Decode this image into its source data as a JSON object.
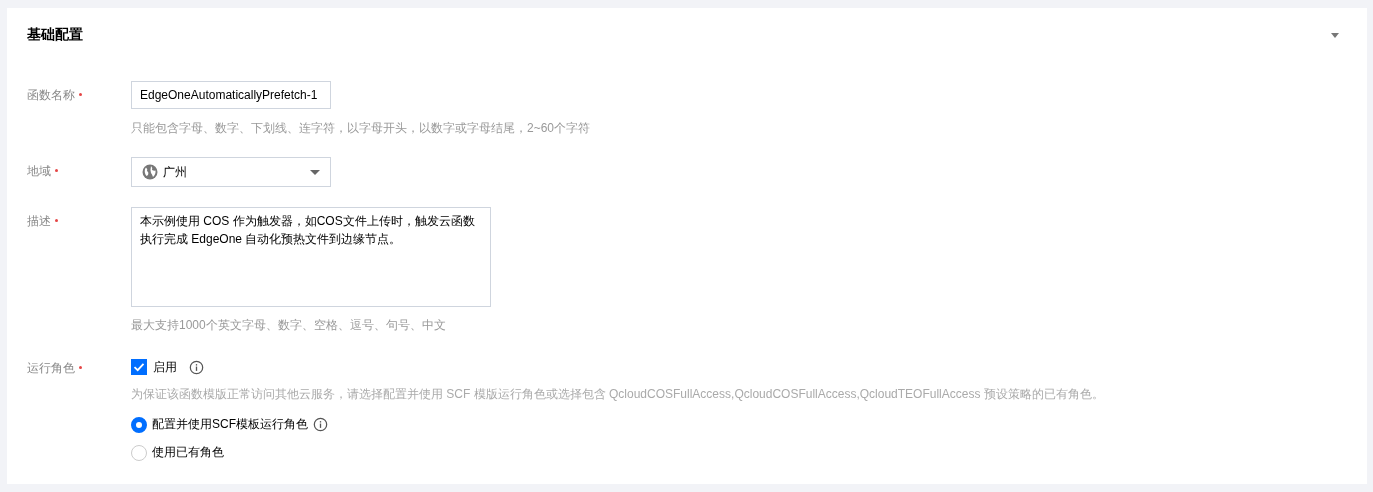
{
  "section": {
    "title": "基础配置",
    "expanded": true
  },
  "fields": [
    {
      "kind": "input",
      "label": "函数名称",
      "required": true,
      "value": "EdgeOneAutomaticallyPrefetch-1",
      "hint": "只能包含字母、数字、下划线、连字符，以字母开头，以数字或字母结尾，2~60个字符"
    },
    {
      "kind": "select",
      "label": "地域",
      "required": true,
      "value": "广州"
    },
    {
      "kind": "textarea",
      "label": "描述",
      "required": true,
      "value": "本示例使用 COS 作为触发器，如COS文件上传时，触发云函数执行完成 EdgeOne 自动化预热文件到边缘节点。",
      "hint": "最大支持1000个英文字母、数字、空格、逗号、句号、中文"
    },
    {
      "kind": "role",
      "label": "运行角色",
      "required": true,
      "checkbox": {
        "label": "启用",
        "checked": true
      },
      "hint": "为保证该函数模版正常访问其他云服务，请选择配置并使用 SCF 模版运行角色或选择包含 QcloudCOSFullAccess,QcloudCOSFullAccess,QcloudTEOFullAccess 预设策略的已有角色。",
      "options": [
        {
          "label": "配置并使用SCF模板运行角色",
          "selected": true,
          "info": true
        },
        {
          "label": "使用已有角色",
          "selected": false,
          "info": false
        }
      ]
    }
  ]
}
